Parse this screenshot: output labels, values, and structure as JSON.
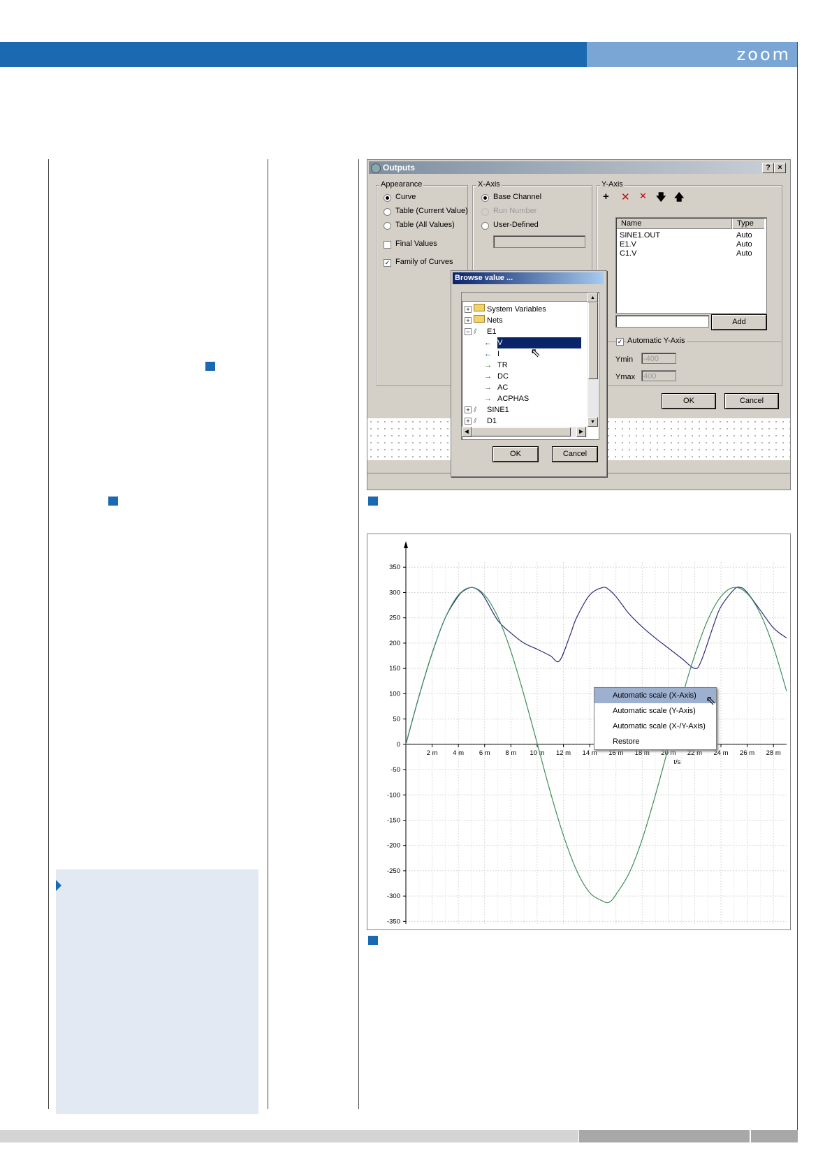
{
  "header": {
    "brand": "zoom"
  },
  "colors": {
    "accent": "#1b6ab1",
    "accent_light": "#7aa6d6",
    "info_bg": "#e3e9f3",
    "curve_blue": "#2b2b7a",
    "curve_green": "#3c8f5a"
  },
  "outputs_dialog": {
    "title": "Outputs",
    "title_buttons": [
      "?",
      "×"
    ],
    "appearance": {
      "caption": "Appearance",
      "options": [
        {
          "label": "Curve",
          "selected": true
        },
        {
          "label": "Table (Current Value)",
          "selected": false
        },
        {
          "label": "Table (All Values)",
          "selected": false
        }
      ],
      "final_values": {
        "label": "Final Values",
        "checked": false
      },
      "family_of_curves": {
        "label": "Family of Curves",
        "checked": true
      }
    },
    "x_axis": {
      "caption": "X-Axis",
      "options": [
        {
          "label": "Base Channel",
          "selected": true,
          "disabled": false
        },
        {
          "label": "Run Number",
          "selected": false,
          "disabled": true
        },
        {
          "label": "User-Defined",
          "selected": false,
          "disabled": false
        }
      ],
      "user_value": ""
    },
    "y_axis": {
      "caption": "Y-Axis",
      "toolbar_icons": [
        "plus-icon",
        "delete-icon",
        "delete-all-icon",
        "move-down-icon",
        "move-up-icon"
      ],
      "columns": [
        "Name",
        "Type"
      ],
      "rows": [
        {
          "name": "SINE1.OUT",
          "type": "Auto"
        },
        {
          "name": "E1.V",
          "type": "Auto"
        },
        {
          "name": "C1.V",
          "type": "Auto"
        }
      ],
      "add_input": "",
      "add_label": "Add",
      "automatic": {
        "label": "Automatic Y-Axis",
        "checked": true
      },
      "ymin_label": "Ymin",
      "ymin_value": "-400",
      "ymax_label": "Ymax",
      "ymax_value": "400"
    },
    "ok_label": "OK",
    "cancel_label": "Cancel"
  },
  "browse_dialog": {
    "title": "Browse value ...",
    "tree": [
      {
        "label": "System Variables",
        "kind": "folder",
        "expander": "+",
        "depth": 0
      },
      {
        "label": "Nets",
        "kind": "folder",
        "expander": "+",
        "depth": 0
      },
      {
        "label": "E1",
        "kind": "component",
        "expander": "−",
        "depth": 0
      },
      {
        "label": "V",
        "kind": "in",
        "depth": 1,
        "selected": true
      },
      {
        "label": "I",
        "kind": "in",
        "depth": 1
      },
      {
        "label": "TR",
        "kind": "out",
        "depth": 1
      },
      {
        "label": "DC",
        "kind": "out",
        "depth": 1
      },
      {
        "label": "AC",
        "kind": "out",
        "depth": 1
      },
      {
        "label": "ACPHAS",
        "kind": "out",
        "depth": 1
      },
      {
        "label": "SINE1",
        "kind": "component",
        "expander": "+",
        "depth": 0
      },
      {
        "label": "D1",
        "kind": "component",
        "expander": "+",
        "depth": 0
      }
    ],
    "ok_label": "OK",
    "cancel_label": "Cancel"
  },
  "context_menu": {
    "items": [
      {
        "label": "Automatic scale (X-Axis)",
        "highlighted": true
      },
      {
        "label": "Automatic scale (Y-Axis)",
        "highlighted": false
      },
      {
        "label": "Automatic scale (X-/Y-Axis)",
        "highlighted": false
      },
      {
        "label": "Restore",
        "highlighted": false
      }
    ]
  },
  "chart_data": {
    "type": "line",
    "xlabel": "t/s",
    "ylabel": "",
    "x_unit_note": "m",
    "xlim": [
      0,
      29
    ],
    "ylim": [
      -350,
      350
    ],
    "x_ticks": [
      2,
      4,
      6,
      8,
      10,
      12,
      14,
      16,
      18,
      20,
      22,
      24,
      26,
      28
    ],
    "x_tick_labels": [
      "2 m",
      "4 m",
      "6 m",
      "8 m",
      "10 m",
      "12 m",
      "14 m",
      "16 m",
      "18 m",
      "20 m",
      "22 m",
      "24 m",
      "26 m",
      "28 m"
    ],
    "y_ticks": [
      350,
      300,
      250,
      200,
      150,
      100,
      50,
      0,
      -50,
      -100,
      -150,
      -200,
      -250,
      -300,
      -350
    ],
    "grid": true,
    "series": [
      {
        "color": "#2b2b7a",
        "x": [
          0,
          1,
          2,
          3,
          4,
          4.5,
          5,
          5.5,
          6,
          7,
          8,
          9,
          10,
          11,
          11.7,
          12.5,
          13,
          14,
          15,
          15.5,
          16,
          16.5,
          17,
          18,
          19,
          20,
          21,
          22,
          22.5,
          23.5,
          24,
          25,
          25.5,
          26,
          27,
          28,
          29
        ],
        "y": [
          0,
          95,
          180,
          250,
          293,
          305,
          310,
          305,
          290,
          245,
          220,
          200,
          188,
          175,
          165,
          215,
          250,
          295,
          310,
          305,
          292,
          275,
          258,
          232,
          210,
          190,
          170,
          150,
          165,
          240,
          272,
          306,
          310,
          300,
          265,
          230,
          210
        ]
      },
      {
        "color": "#3c8f5a",
        "x": [
          0,
          1,
          2,
          3,
          4,
          5,
          6,
          7,
          8,
          9,
          10,
          11,
          12,
          13,
          14,
          15,
          15.5,
          16,
          17,
          18,
          19,
          20,
          21,
          22,
          23,
          24,
          25,
          26,
          27,
          28,
          29
        ],
        "y": [
          0,
          95,
          180,
          250,
          295,
          310,
          295,
          252,
          184,
          97,
          2,
          -94,
          -180,
          -249,
          -293,
          -310,
          -312,
          -297,
          -255,
          -188,
          -101,
          -6,
          90,
          176,
          246,
          292,
          310,
          298,
          258,
          192,
          105
        ]
      }
    ]
  }
}
